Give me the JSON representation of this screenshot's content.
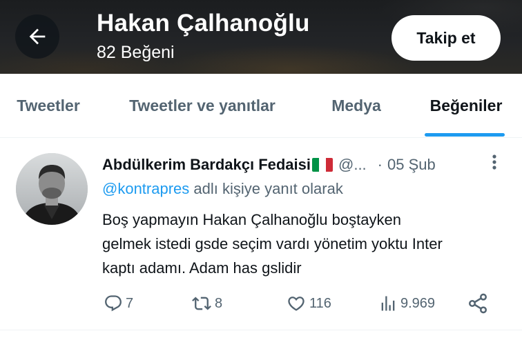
{
  "header": {
    "title": "Hakan Çalhanoğlu",
    "subtitle": "82 Beğeni",
    "back_icon": "arrow-left-icon",
    "follow_label": "Takip et"
  },
  "tabs": [
    {
      "label": "Tweetler",
      "active": false
    },
    {
      "label": "Tweetler ve yanıtlar",
      "active": false
    },
    {
      "label": "Medya",
      "active": false
    },
    {
      "label": "Beğeniler",
      "active": true
    }
  ],
  "tweet": {
    "display_name": "Abdülkerim Bardakçı Fedaisi",
    "flag_icon": "italy-flag-icon",
    "handle": "@...",
    "separator": "·",
    "date": "05 Şub",
    "reply_to_handle": "@kontrapres",
    "reply_suffix": " adlı kişiye yanıt olarak",
    "text_lines": [
      "Boş yapmayın Hakan Çalhanoğlu boştayken",
      "gelmek istedi gsde seçim vardı yönetim yoktu Inter",
      "kaptı adamı. Adam has gslidir"
    ],
    "stats": {
      "replies": "7",
      "retweets": "8",
      "likes": "116",
      "views": "9.969"
    }
  },
  "colors": {
    "accent": "#1d9bf0",
    "text_primary": "#0f1419",
    "text_secondary": "#536471",
    "divider": "#eff3f4"
  }
}
